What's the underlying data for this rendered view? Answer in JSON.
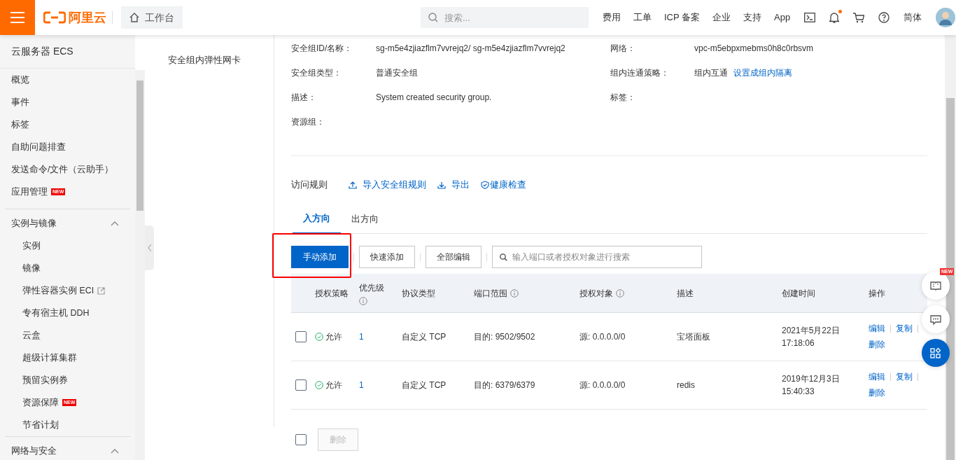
{
  "topbar": {
    "logo": "阿里云",
    "workbench": "工作台",
    "search": {
      "placeholder": "搜索..."
    },
    "nav": [
      "费用",
      "工单",
      "ICP 备案",
      "企业",
      "支持",
      "App"
    ],
    "notification_dot": true,
    "language": "简体"
  },
  "sidebar": {
    "title": "云服务器 ECS",
    "sections": [
      {
        "items": [
          {
            "label": "概览"
          },
          {
            "label": "事件"
          },
          {
            "label": "标签"
          },
          {
            "label": "自助问题排查"
          },
          {
            "label": "发送命令/文件（云助手）"
          },
          {
            "label": "应用管理",
            "badge": "NEW"
          }
        ]
      },
      {
        "title": "实例与镜像",
        "expanded": true,
        "items": [
          {
            "label": "实例"
          },
          {
            "label": "镜像"
          },
          {
            "label": "弹性容器实例 ECI",
            "external": true
          },
          {
            "label": "专有宿主机 DDH"
          },
          {
            "label": "云盒"
          },
          {
            "label": "超级计算集群"
          },
          {
            "label": "预留实例券"
          },
          {
            "label": "资源保障",
            "badge": "NEW"
          },
          {
            "label": "节省计划"
          }
        ]
      },
      {
        "title": "网络与安全",
        "expanded": true
      }
    ]
  },
  "subnav": [
    {
      "label": "安全组内弹性网卡"
    }
  ],
  "details": [
    {
      "label": "安全组ID/名称：",
      "value": "sg-m5e4zjiazflm7vvrejq2/ sg-m5e4zjiazflm7vvrejq2",
      "label_2": "网络：",
      "value_2": "vpc-m5ebpxmebms0h8c0rbsvm"
    },
    {
      "label": "安全组类型：",
      "value": "普通安全组",
      "label_2": "组内连通策略：",
      "value_2": "组内互通",
      "link_2": "设置成组内隔离"
    },
    {
      "label": "描述：",
      "value": "System created security group.",
      "label_2": "标签："
    },
    {
      "label": "资源组："
    }
  ],
  "rules": {
    "title": "访问规则",
    "actions": [
      {
        "kind": "upload",
        "label": "导入安全组规则"
      },
      {
        "kind": "download",
        "label": "导出"
      },
      {
        "kind": "shield",
        "label": "健康检查"
      }
    ],
    "tabs": [
      {
        "label": "入方向",
        "selected": true
      },
      {
        "label": "出方向",
        "selected": false
      }
    ],
    "buttons": [
      {
        "label": "手动添加",
        "primary": true,
        "highlighted": true
      },
      {
        "label": "快速添加",
        "primary": false,
        "highlighted": false
      },
      {
        "label": "全部编辑",
        "primary": false,
        "highlighted": false
      }
    ],
    "search": {
      "placeholder": "输入端口或者授权对象进行搜索"
    },
    "columns": [
      {
        "label": "授权策略"
      },
      {
        "label": "优先级",
        "info": true
      },
      {
        "label": "协议类型"
      },
      {
        "label": "端口范围",
        "info": true
      },
      {
        "label": "授权对象",
        "info": true
      },
      {
        "label": "描述"
      },
      {
        "label": "创建时间"
      },
      {
        "label": "操作"
      }
    ],
    "rows": [
      {
        "checked": false,
        "policy": "允许",
        "priority": "1",
        "protocol": "自定义 TCP",
        "port": "目的: 9502/9502",
        "source": "源: 0.0.0.0/0",
        "description": "宝塔面板",
        "created": [
          "2021年5月22日",
          "17:18:06"
        ],
        "ops": [
          "编辑",
          "复制",
          "删除"
        ]
      },
      {
        "checked": false,
        "policy": "允许",
        "priority": "1",
        "protocol": "自定义 TCP",
        "port": "目的: 6379/6379",
        "source": "源: 0.0.0.0/0",
        "description": "redis",
        "created": [
          "2019年12月3日",
          "15:40:33"
        ],
        "ops": [
          "编辑",
          "复制",
          "删除"
        ]
      }
    ],
    "footer": {
      "checked": false,
      "delete_button": {
        "label": "删除",
        "disabled": true
      }
    }
  },
  "floating": [
    {
      "kind": "book",
      "badge": "NEW"
    },
    {
      "kind": "chat"
    },
    {
      "kind": "apps"
    }
  ]
}
